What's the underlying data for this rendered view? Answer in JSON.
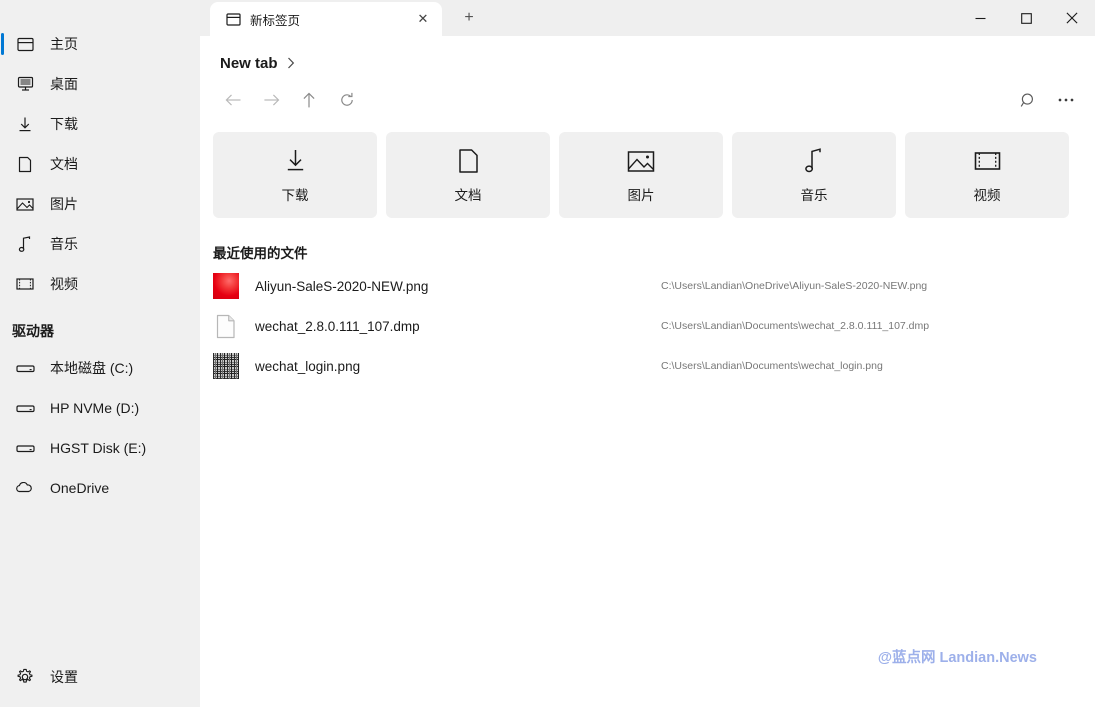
{
  "window": {
    "controls": {
      "minimize": "─",
      "maximize": "□",
      "close": "✕"
    }
  },
  "tabstrip": {
    "tab_title": "新标签页",
    "tab_close": "✕",
    "new_tab": "+"
  },
  "breadcrumb": {
    "label": "New tab",
    "chevron": "›"
  },
  "toolbar": {
    "back": "back-arrow",
    "forward": "forward-arrow",
    "up": "up-arrow",
    "refresh": "refresh-arrow",
    "search": "search-icon",
    "more": "⋯"
  },
  "sidebar": {
    "items": [
      {
        "label": "主页",
        "icon": "home-icon",
        "selected": true
      },
      {
        "label": "桌面",
        "icon": "desktop-icon",
        "selected": false
      },
      {
        "label": "下载",
        "icon": "download-icon",
        "selected": false
      },
      {
        "label": "文档",
        "icon": "document-icon",
        "selected": false
      },
      {
        "label": "图片",
        "icon": "picture-icon",
        "selected": false
      },
      {
        "label": "音乐",
        "icon": "music-icon",
        "selected": false
      },
      {
        "label": "视频",
        "icon": "video-icon",
        "selected": false
      }
    ],
    "drives_title": "驱动器",
    "drives": [
      {
        "label": "本地磁盘 (C:)",
        "icon": "drive-icon"
      },
      {
        "label": "HP NVMe (D:)",
        "icon": "drive-icon"
      },
      {
        "label": "HGST Disk (E:)",
        "icon": "drive-icon"
      },
      {
        "label": "OneDrive",
        "icon": "cloud-icon"
      }
    ],
    "settings": {
      "label": "设置",
      "icon": "gear-icon"
    },
    "accent_color": "#0078d4"
  },
  "tiles": [
    {
      "label": "下载",
      "icon": "download-icon"
    },
    {
      "label": "文档",
      "icon": "document-icon"
    },
    {
      "label": "图片",
      "icon": "picture-icon"
    },
    {
      "label": "音乐",
      "icon": "music-icon"
    },
    {
      "label": "视频",
      "icon": "video-icon"
    }
  ],
  "recent": {
    "title": "最近使用的文件",
    "files": [
      {
        "name": "Aliyun-SaleS-2020-NEW.png",
        "path": "C:\\Users\\Landian\\OneDrive\\Aliyun-SaleS-2020-NEW.png",
        "thumb": "red-gradient-thumbnail"
      },
      {
        "name": "wechat_2.8.0.111_107.dmp",
        "path": "C:\\Users\\Landian\\Documents\\wechat_2.8.0.111_107.dmp",
        "thumb": "generic-file-icon"
      },
      {
        "name": "wechat_login.png",
        "path": "C:\\Users\\Landian\\Documents\\wechat_login.png",
        "thumb": "qr-code-thumbnail"
      }
    ]
  },
  "watermark": {
    "text": "@蓝点网 Landian.News",
    "color": "#9db0ea"
  }
}
